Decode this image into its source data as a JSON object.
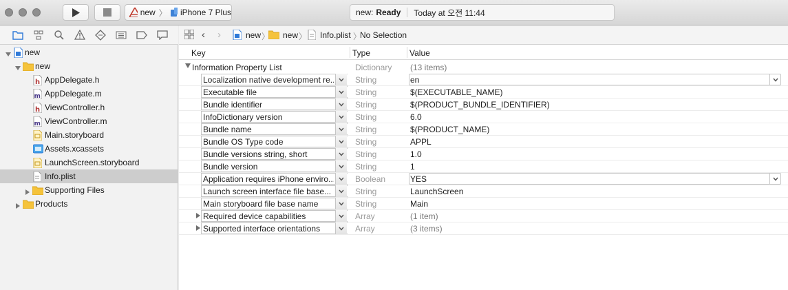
{
  "window": {
    "scheme_project": "new",
    "scheme_device": "iPhone 7 Plus",
    "status_project": "new:",
    "status_state": "Ready",
    "status_time": "Today at 오전 11:44"
  },
  "navigator": {
    "items": [
      {
        "label": "new",
        "kind": "project",
        "level": 0,
        "disclosure": "open"
      },
      {
        "label": "new",
        "kind": "folder",
        "level": 1,
        "disclosure": "open"
      },
      {
        "label": "AppDelegate.h",
        "kind": "h",
        "level": 2
      },
      {
        "label": "AppDelegate.m",
        "kind": "m",
        "level": 2
      },
      {
        "label": "ViewController.h",
        "kind": "h",
        "level": 2
      },
      {
        "label": "ViewController.m",
        "kind": "m",
        "level": 2
      },
      {
        "label": "Main.storyboard",
        "kind": "storyboard",
        "level": 2
      },
      {
        "label": "Assets.xcassets",
        "kind": "assets",
        "level": 2
      },
      {
        "label": "LaunchScreen.storyboard",
        "kind": "storyboard",
        "level": 2
      },
      {
        "label": "Info.plist",
        "kind": "plist",
        "level": 2,
        "selected": true
      },
      {
        "label": "Supporting Files",
        "kind": "folder",
        "level": 2,
        "disclosure": "closed"
      },
      {
        "label": "Products",
        "kind": "folder",
        "level": 1,
        "disclosure": "closed"
      }
    ]
  },
  "jumpbar": {
    "crumbs": [
      "new",
      "new",
      "Info.plist",
      "No Selection"
    ]
  },
  "plist": {
    "headers": {
      "key": "Key",
      "type": "Type",
      "value": "Value"
    },
    "root": {
      "key": "Information Property List",
      "type": "Dictionary",
      "value": "(13 items)"
    },
    "rows": [
      {
        "key": "Localization native development re...",
        "type": "String",
        "value": "en",
        "popup": true
      },
      {
        "key": "Executable file",
        "type": "String",
        "value": "$(EXECUTABLE_NAME)"
      },
      {
        "key": "Bundle identifier",
        "type": "String",
        "value": "$(PRODUCT_BUNDLE_IDENTIFIER)"
      },
      {
        "key": "InfoDictionary version",
        "type": "String",
        "value": "6.0"
      },
      {
        "key": "Bundle name",
        "type": "String",
        "value": "$(PRODUCT_NAME)"
      },
      {
        "key": "Bundle OS Type code",
        "type": "String",
        "value": "APPL"
      },
      {
        "key": "Bundle versions string, short",
        "type": "String",
        "value": "1.0"
      },
      {
        "key": "Bundle version",
        "type": "String",
        "value": "1"
      },
      {
        "key": "Application requires iPhone enviro...",
        "type": "Boolean",
        "value": "YES",
        "popup": true
      },
      {
        "key": "Launch screen interface file base...",
        "type": "String",
        "value": "LaunchScreen"
      },
      {
        "key": "Main storyboard file base name",
        "type": "String",
        "value": "Main"
      },
      {
        "key": "Required device capabilities",
        "type": "Array",
        "value": "(1 item)",
        "expandable": true
      },
      {
        "key": "Supported interface orientations",
        "type": "Array",
        "value": "(3 items)",
        "expandable": true
      }
    ]
  }
}
